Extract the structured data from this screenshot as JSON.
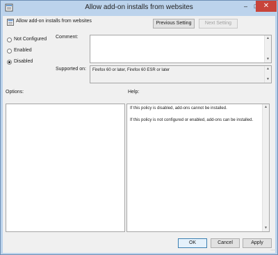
{
  "window": {
    "title": "Allow add-on installs from websites",
    "min_glyph": "–",
    "max_glyph": "□",
    "close_glyph": "✕"
  },
  "policy": {
    "name": "Allow add-on installs from websites"
  },
  "nav": {
    "previous_label": "Previous Setting",
    "next_label": "Next Setting"
  },
  "state": {
    "options": [
      {
        "label": "Not Configured",
        "selected": false
      },
      {
        "label": "Enabled",
        "selected": false
      },
      {
        "label": "Disabled",
        "selected": true
      }
    ]
  },
  "comment": {
    "label": "Comment:",
    "value": ""
  },
  "supported": {
    "label": "Supported on:",
    "value": "Firefox 60 or later, Firefox 60 ESR or later"
  },
  "options_panel": {
    "label": "Options:"
  },
  "help_panel": {
    "label": "Help:",
    "paragraphs": [
      "If this policy is disabled, add-ons cannot be installed.",
      "If this policy is not configured or enabled, add-ons can be installed."
    ]
  },
  "footer": {
    "ok_label": "OK",
    "cancel_label": "Cancel",
    "apply_label": "Apply"
  },
  "icons": {
    "scroll_up": "▲",
    "scroll_down": "▼"
  }
}
